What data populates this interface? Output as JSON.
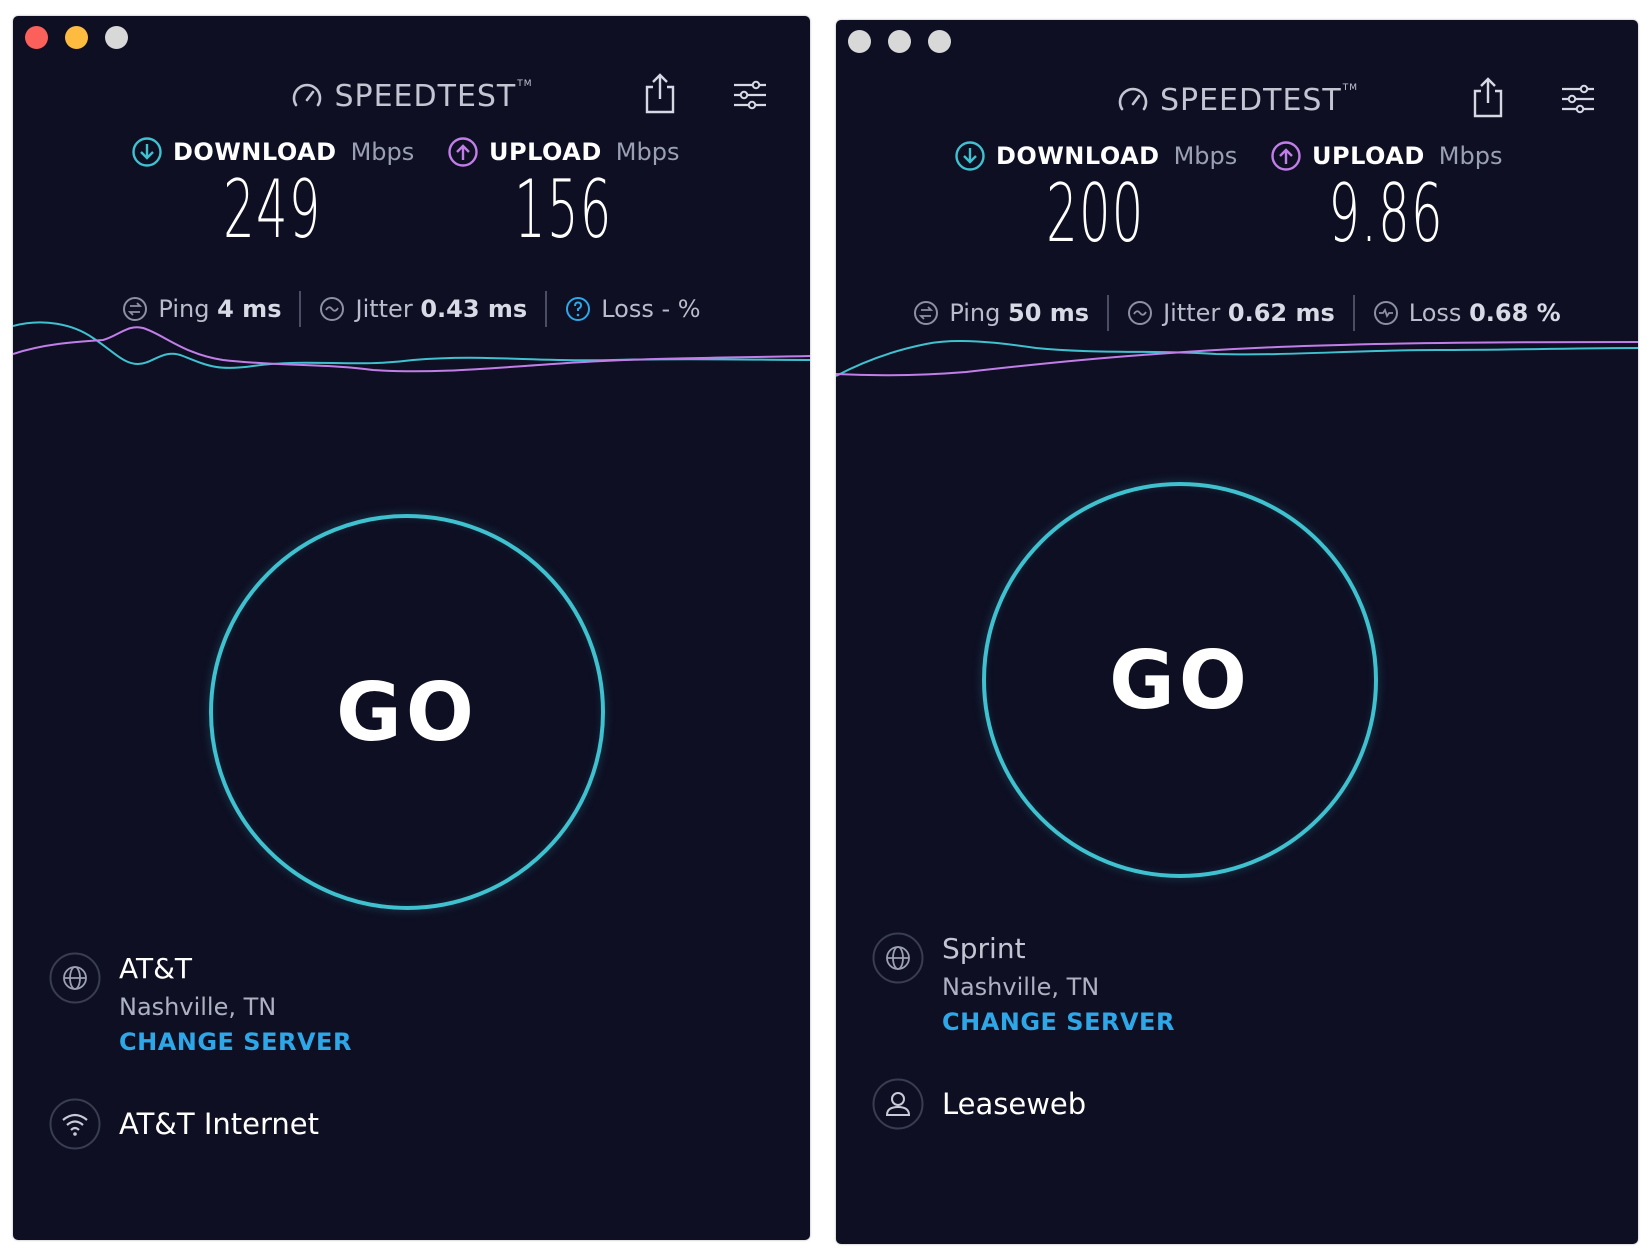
{
  "left_window": {
    "brand": "SPEEDTEST",
    "download": {
      "label": "DOWNLOAD",
      "unit": "Mbps",
      "value": "249"
    },
    "upload": {
      "label": "UPLOAD",
      "unit": "Mbps",
      "value": "156"
    },
    "ping": {
      "label": "Ping",
      "value": "4 ms"
    },
    "jitter": {
      "label": "Jitter",
      "value": "0.43 ms"
    },
    "loss": {
      "label": "Loss",
      "value": "- %"
    },
    "go_label": "GO",
    "server": {
      "name": "AT&T",
      "location": "Nashville, TN",
      "change_label": "CHANGE SERVER"
    },
    "connection": {
      "name": "AT&T Internet",
      "icon": "wifi-icon"
    }
  },
  "right_window": {
    "brand": "SPEEDTEST",
    "download": {
      "label": "DOWNLOAD",
      "unit": "Mbps",
      "value": "200"
    },
    "upload": {
      "label": "UPLOAD",
      "unit": "Mbps",
      "value": "9.86"
    },
    "ping": {
      "label": "Ping",
      "value": "50 ms"
    },
    "jitter": {
      "label": "Jitter",
      "value": "0.62 ms"
    },
    "loss": {
      "label": "Loss",
      "value": "0.68 %"
    },
    "go_label": "GO",
    "server": {
      "name": "Sprint",
      "location": "Nashville, TN",
      "change_label": "CHANGE SERVER"
    },
    "connection": {
      "name": "Leaseweb",
      "icon": "user-icon"
    }
  },
  "colors": {
    "background": "#0e0f23",
    "download_accent": "#3fc1cf",
    "upload_accent": "#c27ee8",
    "change_server": "#2ea7e8",
    "go_ring": "#3fc1cf",
    "light_close": "#fc605b",
    "light_min": "#fdbc40",
    "light_inactive": "#d8d8d8"
  }
}
